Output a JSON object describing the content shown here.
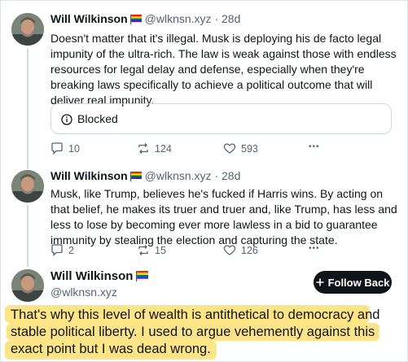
{
  "colors": {
    "accent": "#0f1419",
    "muted": "#536471",
    "highlight": "#fbd33c"
  },
  "posts": [
    {
      "name": "Will Wilkinson",
      "flag": "rainbow-flag-icon",
      "handle": "@wlknsn.xyz",
      "sep": "·",
      "time": "28d",
      "text": "Doesn't matter that it's illegal. Musk is deploying his de facto legal impunity of the ultra-rich. The law is weak against those with endless resources for legal delay and defense, especially when they're breaking laws specifically to achieve a political outcome that will deliver real impunity.",
      "quote": {
        "icon": "info-icon",
        "label": "Blocked"
      },
      "actions": {
        "replies": "10",
        "reposts": "124",
        "likes": "593",
        "more": "•••"
      }
    },
    {
      "name": "Will Wilkinson",
      "flag": "rainbow-flag-icon",
      "handle": "@wlknsn.xyz",
      "sep": "·",
      "time": "28d",
      "text": "Musk, like Trump, believes he's fucked if Harris wins. By acting on that belief, he makes its truer and truer and, like Trump, has less and less to lose by becoming ever more lawless in a bid to guarantee immunity by stealing the election and capturing the state.",
      "actions": {
        "replies": "2",
        "reposts": "15",
        "likes": "126",
        "more": "•••"
      }
    }
  ],
  "main_post": {
    "name": "Will Wilkinson",
    "flag": "rainbow-flag-icon",
    "handle": "@wlknsn.xyz",
    "follow_label": "Follow Back",
    "follow_icon": "plus-icon",
    "text": "That's why this level of wealth is antithetical to democracy and stable political liberty. I used to argue vehemently against this exact point but I was dead wrong."
  }
}
